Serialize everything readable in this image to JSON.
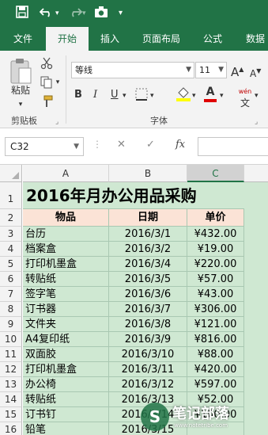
{
  "quick_access": {
    "save_icon": "save-icon",
    "undo_icon": "undo-icon",
    "redo_icon": "redo-icon",
    "camera_icon": "camera-icon",
    "customize_icon": "customize-icon"
  },
  "ribbon_tabs": [
    "文件",
    "开始",
    "插入",
    "页面布局",
    "公式",
    "数据"
  ],
  "active_tab": "开始",
  "clipboard": {
    "paste_label": "粘贴",
    "group_label": "剪贴板"
  },
  "font": {
    "name": "等线",
    "size": "11",
    "group_label": "字体",
    "bold": "B",
    "italic": "I",
    "underline": "U",
    "font_color": "A",
    "increase_size": "A",
    "decrease_size": "A",
    "pinyin_label": "wén",
    "highlight_color": "#ffff00",
    "text_color": "#e00000"
  },
  "formula_bar": {
    "name_box": "C32",
    "cancel": "✕",
    "enter": "✓",
    "fx": "fx",
    "value": ""
  },
  "columns": [
    "A",
    "B",
    "C"
  ],
  "selected_column": "C",
  "row_numbers": [
    "1",
    "2",
    "3",
    "4",
    "5",
    "6",
    "7",
    "8",
    "9",
    "10",
    "11",
    "12",
    "13",
    "14",
    "15",
    "16"
  ],
  "sheet": {
    "title": "2016年月办公用品采购",
    "headers": [
      "物品",
      "日期",
      "单价"
    ],
    "rows": [
      [
        "台历",
        "2016/3/1",
        "¥432.00"
      ],
      [
        "档案盒",
        "2016/3/2",
        "¥19.00"
      ],
      [
        "打印机墨盒",
        "2016/3/4",
        "¥220.00"
      ],
      [
        "转贴纸",
        "2016/3/5",
        "¥57.00"
      ],
      [
        "签字笔",
        "2016/3/6",
        "¥43.00"
      ],
      [
        "订书器",
        "2016/3/7",
        "¥306.00"
      ],
      [
        "文件夹",
        "2016/3/8",
        "¥121.00"
      ],
      [
        "A4复印纸",
        "2016/3/9",
        "¥816.00"
      ],
      [
        "双面胶",
        "2016/3/10",
        "¥88.00"
      ],
      [
        "打印机墨盒",
        "2016/3/11",
        "¥420.00"
      ],
      [
        "办公椅",
        "2016/3/12",
        "¥597.00"
      ],
      [
        "转贴纸",
        "2016/3/13",
        "¥52.00"
      ],
      [
        "订书钉",
        "2016/3/14",
        "¥100.00"
      ],
      [
        "铅笔",
        "2016/3/15",
        ""
      ]
    ]
  },
  "watermark": {
    "logo": "S",
    "name": "笔记部落",
    "url": "www.notetribe.com"
  },
  "colors": {
    "excel_green": "#217346",
    "cell_fill": "#cfe8d2",
    "header_fill": "#fbe3d6"
  }
}
